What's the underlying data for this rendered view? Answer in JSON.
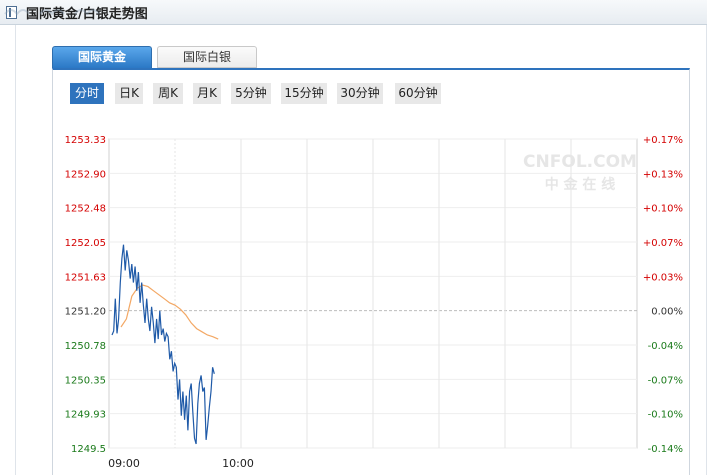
{
  "window": {
    "title": "国际黄金/白银走势图"
  },
  "tabs": [
    {
      "label": "国际黄金",
      "active": true
    },
    {
      "label": "国际白银",
      "active": false
    }
  ],
  "periods": [
    {
      "label": "分时",
      "selected": true
    },
    {
      "label": "日K",
      "selected": false
    },
    {
      "label": "周K",
      "selected": false
    },
    {
      "label": "月K",
      "selected": false
    },
    {
      "label": "5分钟",
      "selected": false
    },
    {
      "label": "15分钟",
      "selected": false
    },
    {
      "label": "30分钟",
      "selected": false
    },
    {
      "label": "60分钟",
      "selected": false
    }
  ],
  "watermark": {
    "logo": "CNFOL.COM",
    "sub": "中 金 在 线"
  },
  "colors": {
    "up": "#d40000",
    "down": "#1a7a1a",
    "neutral": "#333333",
    "price_line": "#1f5aa8",
    "avg_line": "#f3a865",
    "accent": "#2e73bd"
  },
  "chart_data": {
    "type": "line",
    "base_price": 1251.2,
    "y_ticks_left": [
      "1253.33",
      "1252.90",
      "1252.48",
      "1252.05",
      "1251.63",
      "1251.20",
      "1250.78",
      "1250.35",
      "1249.93",
      "1249.5"
    ],
    "y_ticks_right": [
      "+0.17%",
      "+0.13%",
      "+0.10%",
      "+0.07%",
      "+0.03%",
      "0.00%",
      "-0.04%",
      "-0.07%",
      "-0.10%",
      "-0.14%"
    ],
    "x_ticks": [
      "09:00",
      "10:00"
    ],
    "ylim": [
      1249.5,
      1253.33
    ],
    "series": [
      {
        "values": [
          1250.9,
          1250.95,
          1251.35,
          1250.92,
          1251.1,
          1251.55,
          1251.85,
          1252.02,
          1251.7,
          1251.95,
          1251.82,
          1251.6,
          1251.78,
          1251.55,
          1251.75,
          1251.45,
          1251.68,
          1251.3,
          1251.55,
          1251.28,
          1251.05,
          1251.35,
          1251.1,
          1250.95,
          1251.25,
          1251.05,
          1250.8,
          1251.1,
          1250.85,
          1251.2,
          1250.9,
          1250.98,
          1250.82,
          1250.92,
          1250.88,
          1250.6,
          1250.7,
          1250.45,
          1250.55,
          1250.5,
          1250.1,
          1250.35,
          1249.9,
          1250.2,
          1249.85,
          1250.15,
          1249.72,
          1250.2,
          1250.3,
          1249.95,
          1249.62,
          1249.55,
          1250.05,
          1250.3,
          1250.4,
          1250.2,
          1250.25,
          1249.6,
          1249.78,
          1250.0,
          1250.2,
          1250.5,
          1250.42
        ]
      },
      {
        "values": [
          1251.0,
          1251.1,
          1251.38,
          1251.48,
          1251.52,
          1251.5,
          1251.45,
          1251.4,
          1251.35,
          1251.3,
          1251.27,
          1251.22,
          1251.15,
          1251.05,
          1250.98,
          1250.94,
          1250.9,
          1250.88,
          1250.85
        ]
      }
    ]
  }
}
